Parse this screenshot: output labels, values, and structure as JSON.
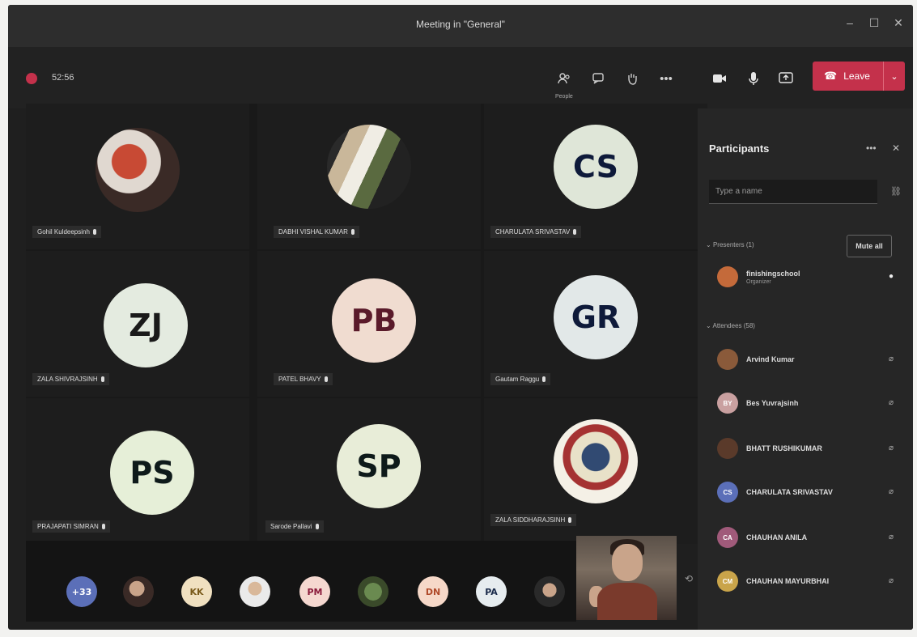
{
  "window": {
    "title": "Meeting in \"General\"",
    "minimize": "–",
    "maximize": "☐",
    "close": "✕"
  },
  "toolbar": {
    "timer": "52:56",
    "participants_label": "People",
    "chat_icon": "chat-icon",
    "raise_hand_icon": "hand-icon",
    "more": "•••",
    "camera_icon": "camera-icon",
    "mic_icon": "mic-icon",
    "share_icon": "share-icon",
    "leave_label": "Leave",
    "leave_dropdown": "⌄",
    "leave_color": "#c4314b"
  },
  "stage": {
    "tiles": [
      {
        "name": "Gohil Kuldeepsinh",
        "avatar_type": "photo"
      },
      {
        "name": "DABHI VISHAL KUMAR",
        "avatar_type": "photo"
      },
      {
        "name": "CHARULATA SRIVASTAV",
        "initials": "CS"
      },
      {
        "name": "ZALA SHIVRAJSINH",
        "initials": "ZJ"
      },
      {
        "name": "PATEL BHAVY",
        "initials": "PB"
      },
      {
        "name": "Gautam Raggu",
        "initials": "GR"
      },
      {
        "name": "PRAJAPATI SIMRAN",
        "initials": "PS"
      },
      {
        "name": "Sarode Pallavi",
        "initials": "SP"
      },
      {
        "name": "ZALA SIDDHARAJSINH",
        "avatar_type": "photo"
      }
    ]
  },
  "strip": {
    "overflow": "+33",
    "items": [
      "",
      "KK",
      "",
      "PM",
      "",
      "DN",
      "PA",
      ""
    ]
  },
  "panel": {
    "title": "Participants",
    "more": "•••",
    "close": "✕",
    "search_placeholder": "Type a name",
    "presenters_label": "Presenters (1)",
    "mute_all": "Mute all",
    "presenter": {
      "name": "finishingschool",
      "role": "Organizer"
    },
    "attendees_label": "Attendees (58)",
    "attendees": [
      {
        "name": "Arvind Kumar",
        "initials": "",
        "color": "#8a5a3a"
      },
      {
        "name": "Bes Yuvrajsinh",
        "initials": "BY",
        "color": "#c9a0a0"
      },
      {
        "name": "BHATT RUSHIKUMAR",
        "initials": "",
        "color": "#5a3a2a"
      },
      {
        "name": "CHARULATA SRIVASTAV",
        "initials": "CS",
        "color": "#5b6fb8"
      },
      {
        "name": "CHAUHAN ANILA",
        "initials": "CA",
        "color": "#a05a7a"
      },
      {
        "name": "CHAUHAN MAYURBHAI",
        "initials": "CM",
        "color": "#c9a44a"
      }
    ]
  }
}
